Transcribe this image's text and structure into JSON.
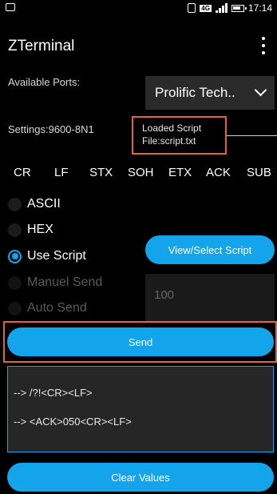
{
  "status_bar": {
    "network": "4G",
    "time": "17:14"
  },
  "app": {
    "title": "ZTerminal"
  },
  "ports": {
    "label": "Available Ports:",
    "selected": "Prolific Tech.."
  },
  "settings": {
    "text": "Settings:9600-8N1"
  },
  "script_info": {
    "line1": "Loaded Script",
    "line2": "File:script.txt"
  },
  "control_chars": [
    "CR",
    "LF",
    "STX",
    "SOH",
    "ETX",
    "ACK",
    "SUB"
  ],
  "modes": [
    {
      "label": "ASCII",
      "selected": false,
      "enabled": true
    },
    {
      "label": "HEX",
      "selected": false,
      "enabled": true
    },
    {
      "label": "Use Script",
      "selected": true,
      "enabled": true
    },
    {
      "label": "Manuel Send",
      "selected": false,
      "enabled": false
    },
    {
      "label": "Auto Send",
      "selected": false,
      "enabled": false
    }
  ],
  "view_script_button": "View/Select Script",
  "interval_input": {
    "placeholder": "100"
  },
  "send_button": "Send",
  "output": [
    "--> /?!<CR><LF>",
    "--> <ACK>050<CR><LF>"
  ],
  "clear_button": "Clear Values",
  "colors": {
    "accent": "#13a4eb",
    "highlight": "#e0643c",
    "background": "#000000"
  }
}
